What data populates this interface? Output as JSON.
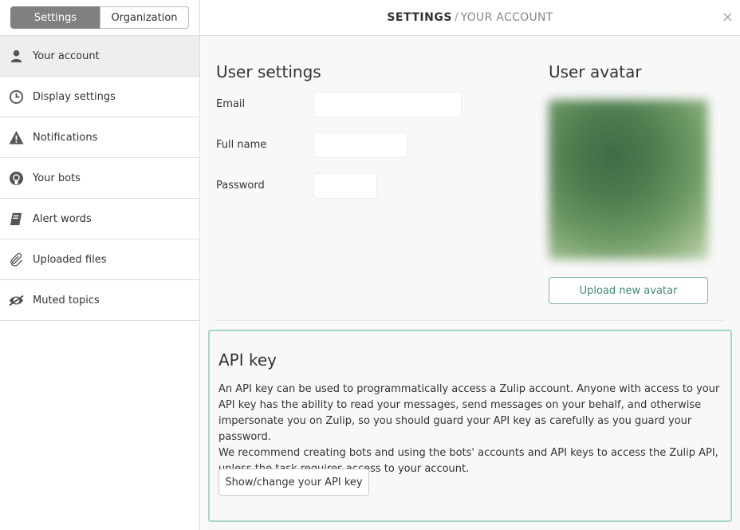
{
  "tabs": {
    "settings": "Settings",
    "organization": "Organization"
  },
  "header": {
    "title_strong": "SETTINGS",
    "separator": "/",
    "title_rest": "YOUR ACCOUNT",
    "close": "×"
  },
  "sidebar": {
    "items": [
      {
        "label": "Your account",
        "icon": "user-icon",
        "active": true
      },
      {
        "label": "Display settings",
        "icon": "clock-icon"
      },
      {
        "label": "Notifications",
        "icon": "warning-icon"
      },
      {
        "label": "Your bots",
        "icon": "github-icon"
      },
      {
        "label": "Alert words",
        "icon": "book-icon"
      },
      {
        "label": "Uploaded files",
        "icon": "paperclip-icon"
      },
      {
        "label": "Muted topics",
        "icon": "eye-slash-icon"
      }
    ]
  },
  "user_settings": {
    "title": "User settings",
    "email_label": "Email",
    "email_value": "",
    "full_name_label": "Full name",
    "full_name_value": "",
    "password_label": "Password",
    "password_value": ""
  },
  "avatar": {
    "title": "User avatar",
    "upload_button": "Upload new avatar"
  },
  "api_key": {
    "title": "API key",
    "description_1": "An API key can be used to programmatically access a Zulip account. Anyone with access to your API key has the ability to read your messages, send messages on your behalf, and otherwise impersonate you on Zulip, so you should guard your API key as carefully as you guard your password.",
    "description_2": "We recommend creating bots and using the bots' accounts and API keys to access the Zulip API, unless the task requires access to your account.",
    "button": "Show/change your API key"
  },
  "colors": {
    "accent_green": "#3f8a6d",
    "api_box_border": "#a8d6c4",
    "active_tab_bg": "#808080"
  }
}
